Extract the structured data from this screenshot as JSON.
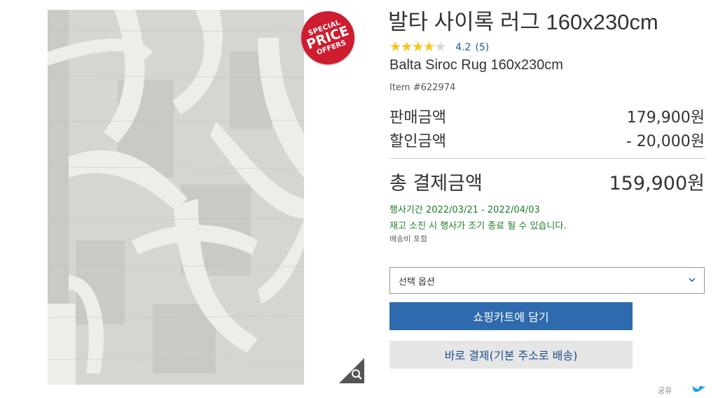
{
  "product": {
    "title_ko": "발타 사이록 러그 160x230cm",
    "title_en": "Balta Siroc Rug 160x230cm",
    "item_number": "Item #622974",
    "rating": {
      "value_text": "4.2",
      "count_text": "(5)",
      "stars": 4.2,
      "max_stars": 5
    }
  },
  "badge": {
    "line1": "SPECIAL",
    "line2": "PRICE",
    "line3": "OFFERS",
    "color": "#cf1d2f"
  },
  "pricing": {
    "sale_label": "판매금액",
    "sale_value": "179,900원",
    "discount_label": "할인금액",
    "discount_value": "- 20,000원",
    "total_label": "총 결제금액",
    "total_value": "159,900원"
  },
  "promo": {
    "period": "행사기간 2022/03/21 - 2022/04/03",
    "notice": "재고 소진 시 행사가 조기 종료 될 수 있습니다.",
    "shipping": "배송비 포함",
    "color": "#1e7d2b"
  },
  "options": {
    "selected_text": "선택 옵션"
  },
  "actions": {
    "add_to_cart": "쇼핑카트에 담기",
    "buy_now": "바로 결제(기본 주소로 배송)",
    "primary_color": "#2e6aad"
  },
  "share": {
    "label": "공유"
  },
  "icons": {
    "zoom": "zoom-icon",
    "chevron": "chevron-down-icon",
    "twitter": "twitter-icon",
    "star": "star-icon"
  }
}
